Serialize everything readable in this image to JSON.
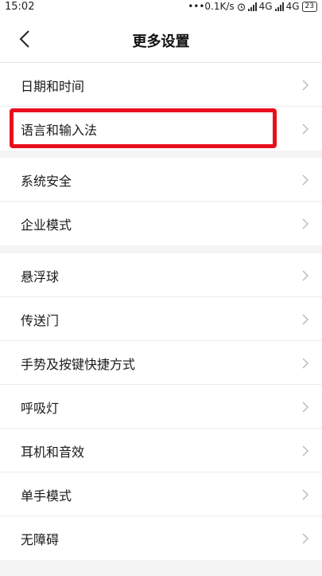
{
  "status_bar": {
    "time": "15:02",
    "speed": "•••0.1K/s",
    "net1": "4G",
    "net2": "4G",
    "battery": "23",
    "alarm_icon": "alarm-icon"
  },
  "header": {
    "title": "更多设置",
    "back_icon": "back-arrow-icon"
  },
  "groups": [
    [
      "日期和时间",
      "语言和输入法"
    ],
    [
      "系统安全",
      "企业模式"
    ],
    [
      "悬浮球",
      "传送门",
      "手势及按键快捷方式",
      "呼吸灯",
      "耳机和音效",
      "单手模式",
      "无障碍"
    ]
  ],
  "colors": {
    "highlight": "#e8101d",
    "background": "#f4f4f4",
    "chevron": "#bdbdbd"
  },
  "highlighted_item": "语言和输入法"
}
